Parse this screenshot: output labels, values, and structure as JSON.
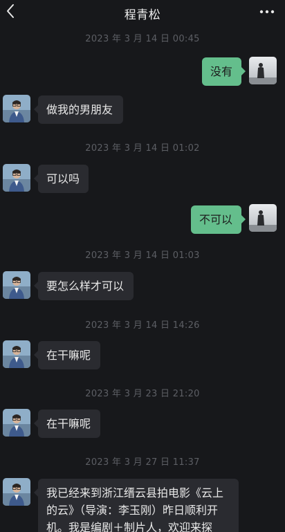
{
  "header": {
    "title": "程青松",
    "back_icon": "chevron-left-icon",
    "more_icon": "more-dots-icon"
  },
  "colors": {
    "background": "#17181b",
    "incoming_bubble": "#2a2b30",
    "outgoing_bubble": "#64be8c",
    "timestamp": "#5d5f65"
  },
  "messages": [
    {
      "type": "timestamp",
      "text": "2023 年 3 月 14 日 00:45"
    },
    {
      "type": "message",
      "direction": "out",
      "text": "没有"
    },
    {
      "type": "message",
      "direction": "in",
      "text": "做我的男朋友"
    },
    {
      "type": "timestamp",
      "text": "2023 年 3 月 14 日 01:02"
    },
    {
      "type": "message",
      "direction": "in",
      "text": "可以吗"
    },
    {
      "type": "message",
      "direction": "out",
      "text": "不可以"
    },
    {
      "type": "timestamp",
      "text": "2023 年 3 月 14 日 01:03"
    },
    {
      "type": "message",
      "direction": "in",
      "text": "要怎么样才可以"
    },
    {
      "type": "timestamp",
      "text": "2023 年 3 月 14 日 14:26"
    },
    {
      "type": "message",
      "direction": "in",
      "text": "在干嘛呢"
    },
    {
      "type": "timestamp",
      "text": "2023 年 3 月 23 日 21:20"
    },
    {
      "type": "message",
      "direction": "in",
      "text": "在干嘛呢"
    },
    {
      "type": "timestamp",
      "text": "2023 年 3 月 27 日 11:37"
    },
    {
      "type": "message",
      "direction": "in",
      "text": "我已经来到浙江缙云县拍电影《云上的云》（导演：李玉刚）昨日顺利开机。我是编剧＋制片人，欢迎来探"
    }
  ]
}
